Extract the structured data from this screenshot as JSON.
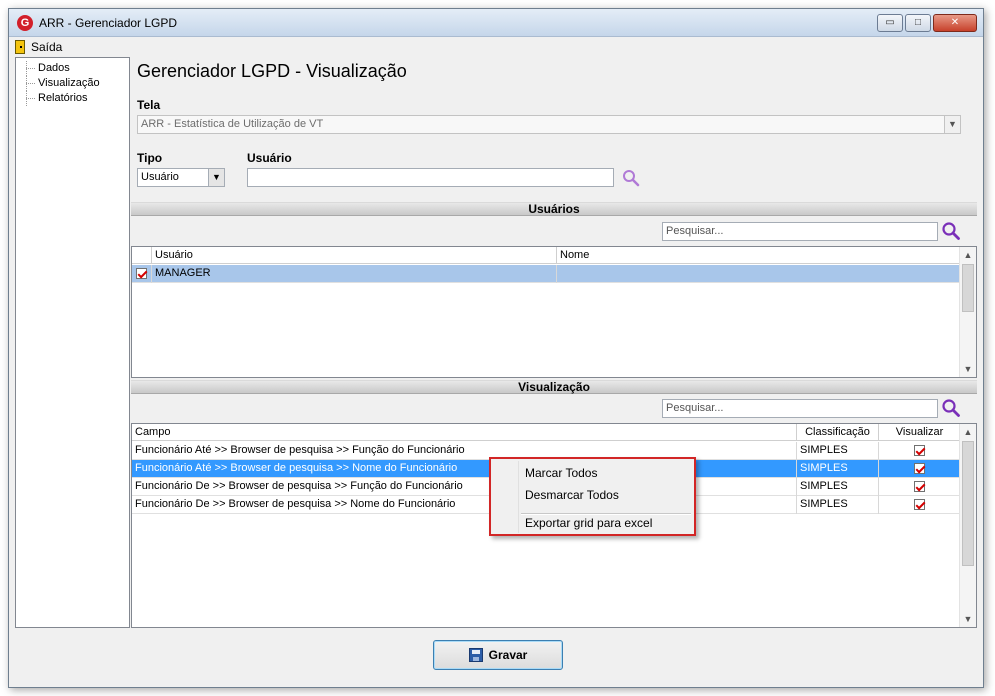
{
  "window": {
    "title": "ARR - Gerenciador LGPD",
    "app_icon": "G",
    "controls": {
      "minimize": "▭",
      "maximize": "□",
      "close": "✕"
    }
  },
  "menu": {
    "exit_label": "Saída"
  },
  "sidebar": {
    "items": [
      {
        "label": "Dados"
      },
      {
        "label": "Visualização"
      },
      {
        "label": "Relatórios"
      }
    ]
  },
  "page": {
    "title": "Gerenciador LGPD - Visualização",
    "tela_label": "Tela",
    "tela_value": "ARR - Estatística de Utilização de VT",
    "tipo_label": "Tipo",
    "tipo_value": "Usuário",
    "usuario_label": "Usuário",
    "usuario_value": ""
  },
  "users_section": {
    "title": "Usuários",
    "search_placeholder": "Pesquisar...",
    "columns": [
      "Usuário",
      "Nome"
    ],
    "rows": [
      {
        "checked": true,
        "usuario": "MANAGER",
        "nome": ""
      }
    ]
  },
  "view_section": {
    "title": "Visualização",
    "search_placeholder": "Pesquisar...",
    "columns": [
      "Campo",
      "Classificação",
      "Visualizar"
    ],
    "rows": [
      {
        "campo": "Funcionário Até >> Browser de pesquisa >> Função do Funcionário",
        "classificacao": "SIMPLES",
        "visualizar": true
      },
      {
        "campo": "Funcionário Até >> Browser de pesquisa >> Nome do Funcionário",
        "classificacao": "SIMPLES",
        "visualizar": true
      },
      {
        "campo": "Funcionário De >> Browser de pesquisa >> Função do Funcionário",
        "classificacao": "SIMPLES",
        "visualizar": true
      },
      {
        "campo": "Funcionário De >> Browser de pesquisa >> Nome do Funcionário",
        "classificacao": "SIMPLES",
        "visualizar": true
      }
    ]
  },
  "context_menu": {
    "items": [
      "Marcar Todos",
      "Desmarcar Todos",
      "Exportar grid para excel"
    ]
  },
  "footer": {
    "save_label": "Gravar"
  },
  "colors": {
    "selection_light": "#a8c6ea",
    "selection_dark": "#3399ff",
    "accent_search": "#7a2fb8",
    "context_border": "#d22626",
    "check_mark": "#d40000"
  }
}
